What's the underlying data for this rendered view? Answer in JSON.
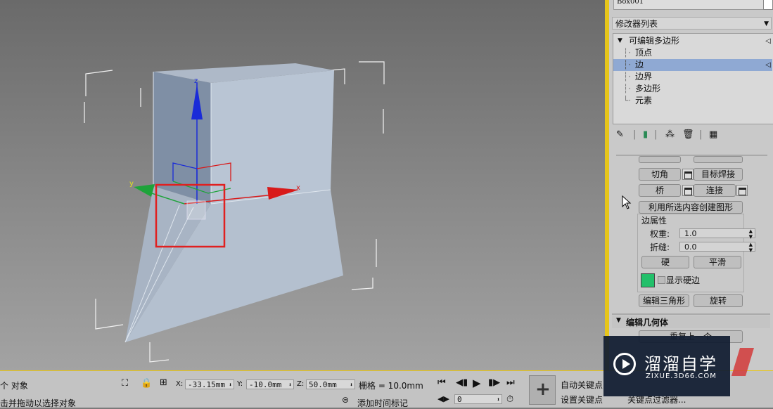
{
  "colors": {
    "accent_yellow": "#e6c51a",
    "selection_blue": "#8fa9d3",
    "hard_edge_color": "#22c06a",
    "gizmo_z": "#1a2bd8",
    "gizmo_x": "#d81a1a",
    "gizmo_y": "#1ea33a",
    "selection_box": "#e02020"
  },
  "viewport": {
    "gizmo": {
      "z_label": "z",
      "x_label": "x",
      "y_label": "y"
    }
  },
  "panel": {
    "object_name": "Box001",
    "modifier_list_label": "修改器列表",
    "stack": {
      "root": "可编辑多边形",
      "items": [
        "顶点",
        "边",
        "边界",
        "多边形",
        "元素"
      ],
      "selected_index": 1
    },
    "toolbar_icons": [
      "pin-icon",
      "show-end-result-icon",
      "make-unique-icon",
      "remove-modifier-icon",
      "configure-modifier-sets-icon"
    ],
    "edit_edges": {
      "chamfer": "切角",
      "target_weld": "目标焊接",
      "bridge": "桥",
      "connect": "连接",
      "create_shape": "利用所选内容创建图形",
      "edge_properties": "边属性",
      "weight_label": "权重:",
      "weight_value": "1.0",
      "crease_label": "折缝:",
      "crease_value": "0.0",
      "hard": "硬",
      "smooth": "平滑",
      "show_hard_edges": "显示硬边",
      "edit_triangulation": "编辑三角形",
      "turn": "旋转"
    },
    "edit_geometry": {
      "title": "编辑几何体",
      "repeat_last": "重复上一个"
    }
  },
  "bottom": {
    "selection_count": "个 对象",
    "prompt": "击并拖动以选择对象",
    "x_label": "X:",
    "x_value": "-33.15mm",
    "y_label": "Y:",
    "y_value": "-10.0mm",
    "z_label": "Z:",
    "z_value": "50.0mm",
    "grid": "栅格 = 10.0mm",
    "add_time_tag": "添加时间标记",
    "frame_value": "0",
    "auto_key": "自动关键点",
    "set_key": "设置关键点",
    "key_filters": "关键点过滤器..."
  },
  "watermark": {
    "title": "溜溜自学",
    "url": "ZIXUE.3D66.COM"
  }
}
